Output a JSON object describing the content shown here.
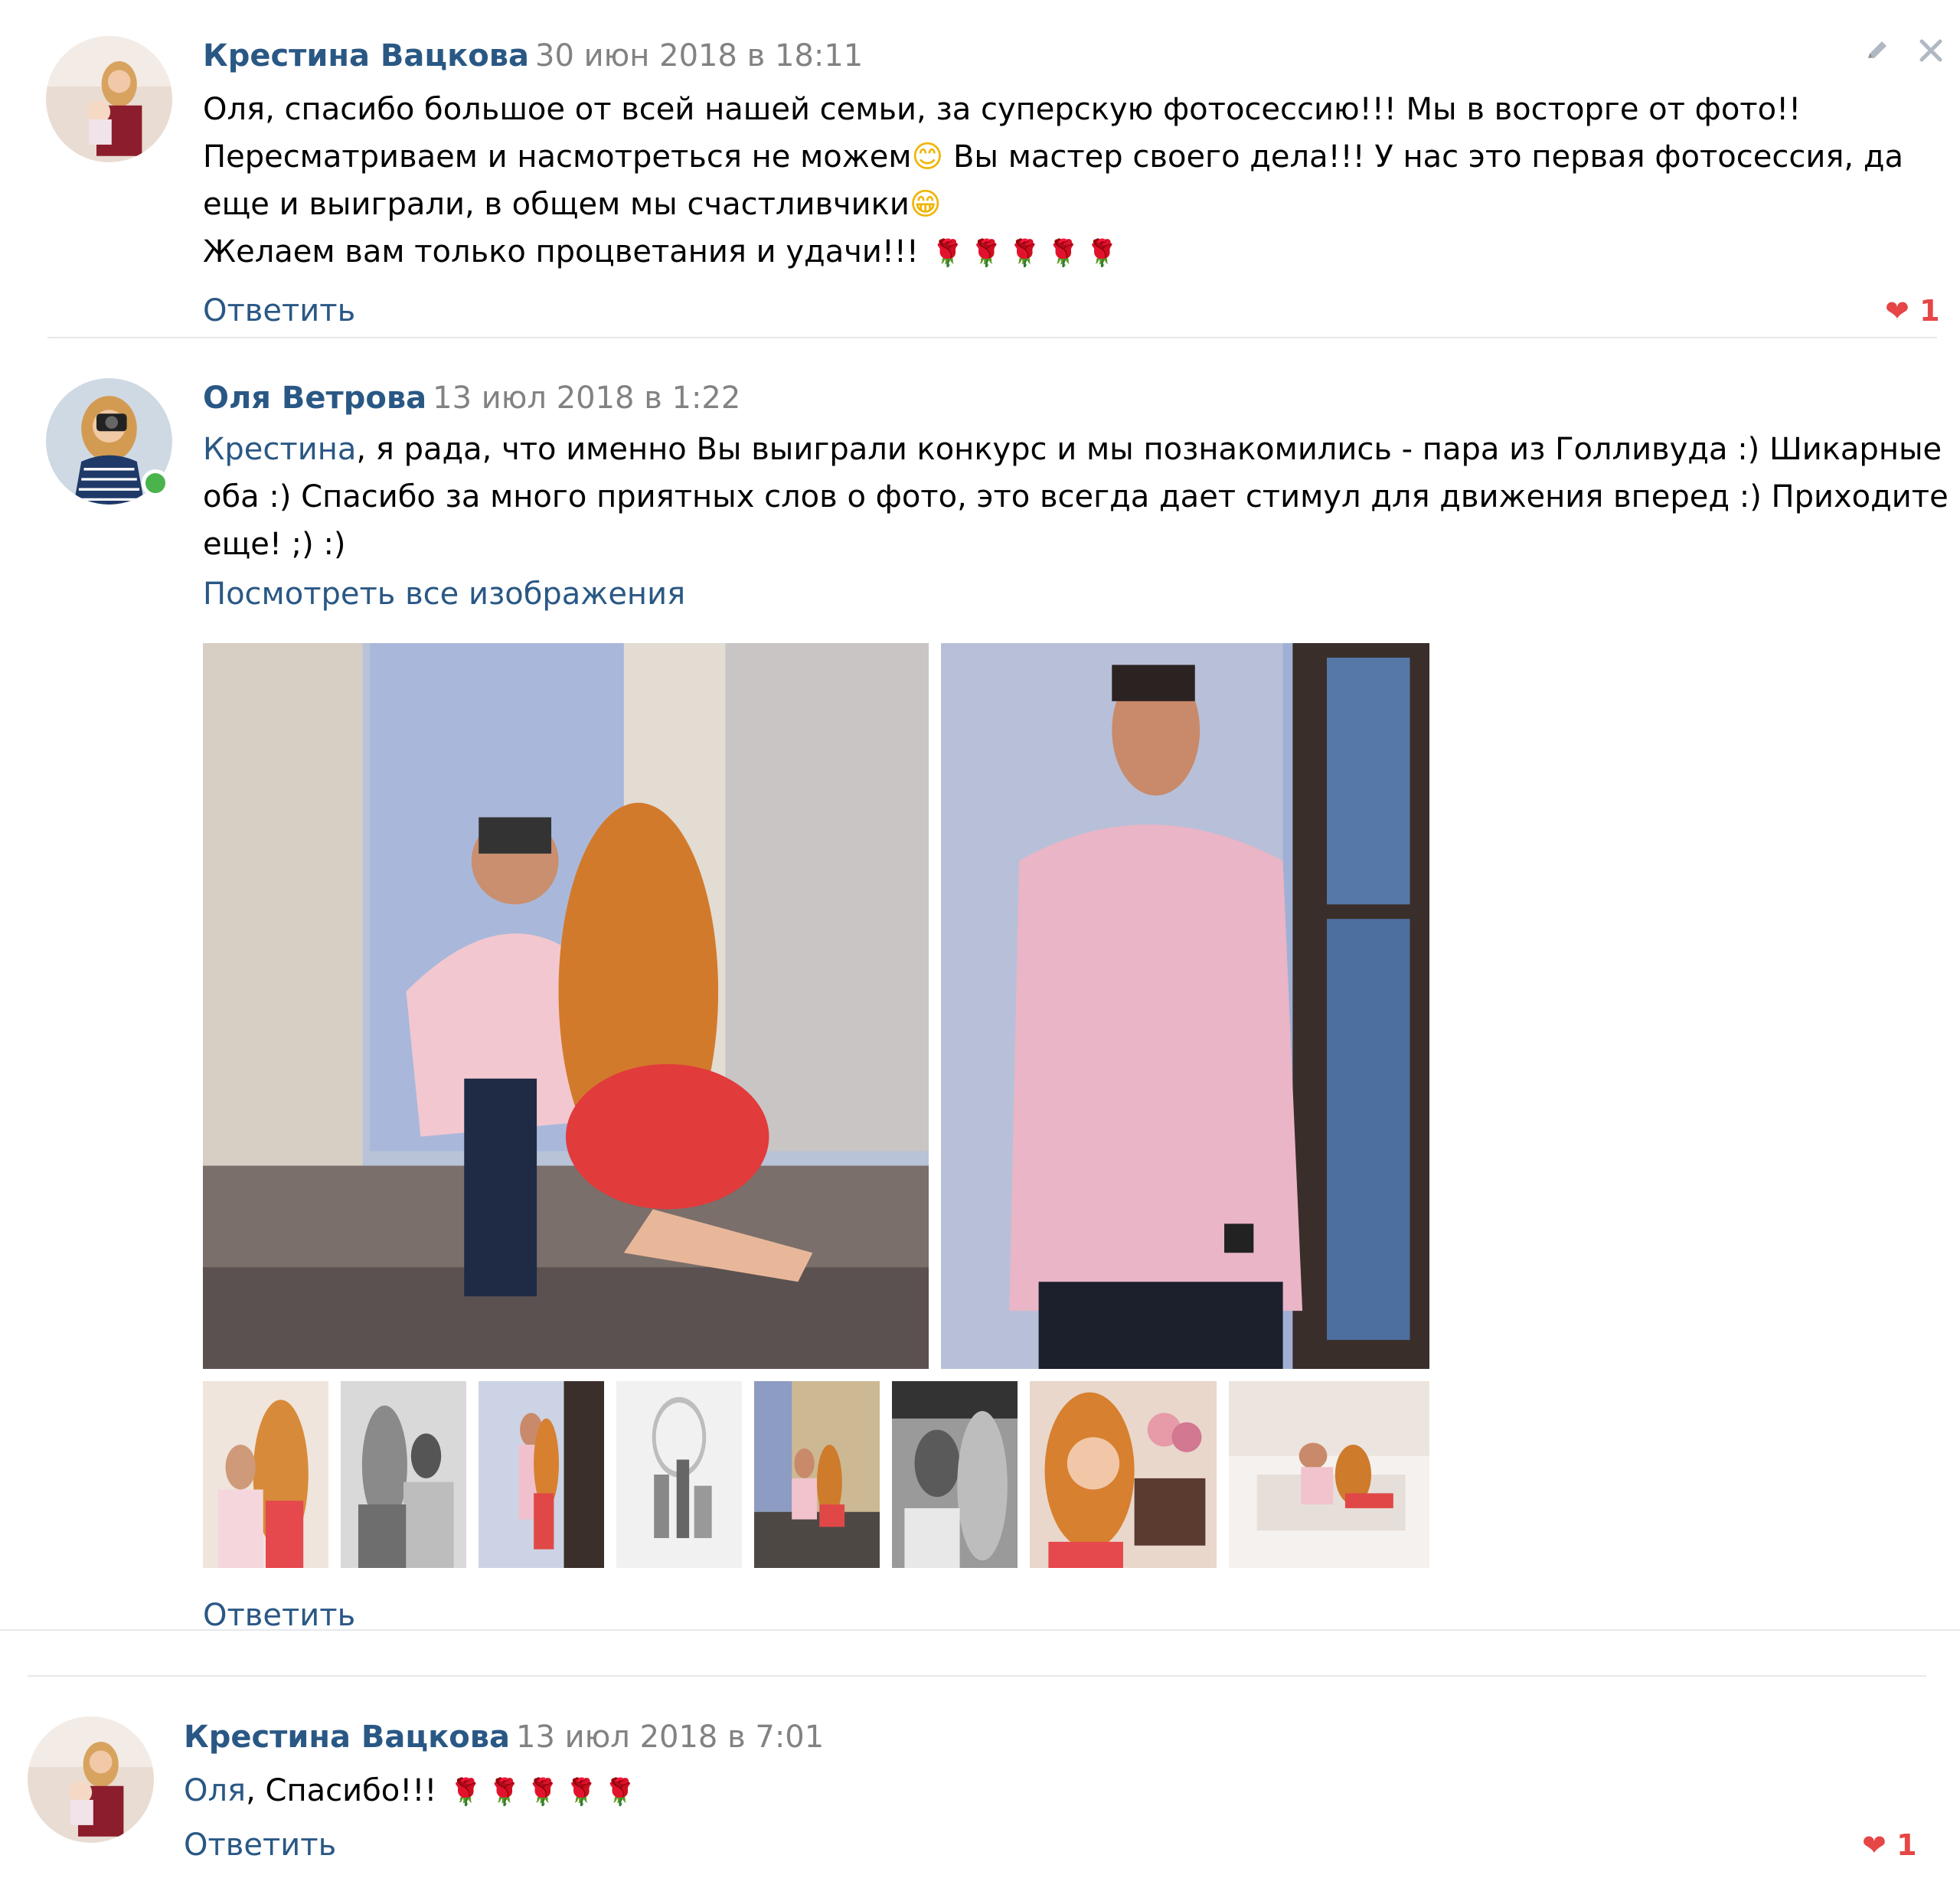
{
  "comments": [
    {
      "author": "Крестина Вацкова",
      "date": "30 июн 2018 в 18:11",
      "lines": [
        "Оля, спасибо большое от всей нашей семьи, за суперскую фотосессию!!! Мы в восторге от фото!!",
        "Пересматриваем и насмотреться не можем",
        " Вы мастер своего дела!!! У нас это первая фотосессия, да",
        "еще и выиграли, в общем мы счастливчики",
        "Желаем вам только процветания и удачи!!! "
      ],
      "reply_label": "Ответить",
      "likes": "1"
    },
    {
      "author": "Оля Ветрова",
      "date": "13 июл 2018 в 1:22",
      "mention": "Крестина",
      "lines": [
        ", я рада, что именно Вы выиграли конкурс и мы познакомились - пара из Голливуда :) Шикарные",
        "оба :) Спасибо за много приятных слов о фото, это всегда дает стимул для движения вперед :) Приходите",
        "еще! ;) :)"
      ],
      "view_all_label": "Посмотреть все изображения",
      "reply_label": "Ответить"
    },
    {
      "author": "Крестина Вацкова",
      "date": "13 июл 2018 в 7:01",
      "mention": "Оля",
      "text": ", Спасибо!!! ",
      "reply_label": "Ответить",
      "likes": "1"
    }
  ],
  "icons": {
    "edit": "pencil-icon",
    "close": "close-icon",
    "like": "heart-icon",
    "emoji_smile": "smile-emoji",
    "emoji_grin": "grin-emoji",
    "rose": "rose-emoji"
  },
  "colors": {
    "link": "#2a5885",
    "date": "#828282",
    "like": "#e64646",
    "divider": "#e7e8ec",
    "online": "#4bb34b"
  }
}
